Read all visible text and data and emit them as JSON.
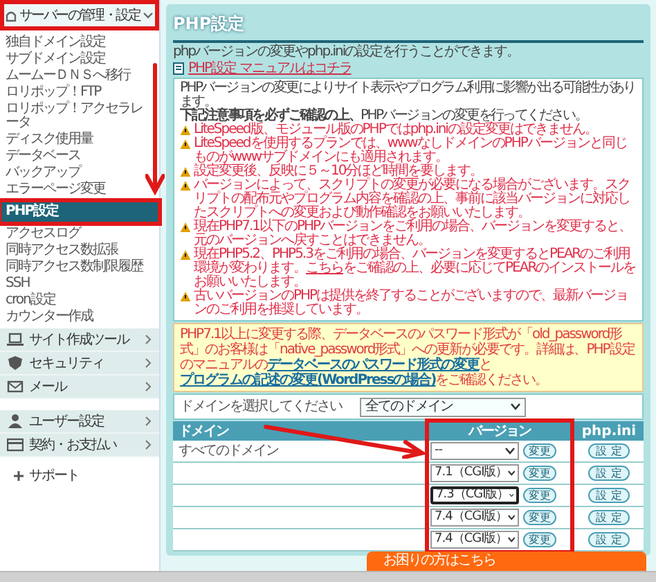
{
  "sidebar": {
    "section": {
      "label": "サーバーの管理・設定",
      "expanded": true
    },
    "items": [
      {
        "label": "独自ドメイン設定",
        "selected": false
      },
      {
        "label": "サブドメイン設定",
        "selected": false
      },
      {
        "label": "ムームーＤＮＳへ移行",
        "selected": false
      },
      {
        "label": "ロリポップ！FTP",
        "selected": false
      },
      {
        "label": "ロリポップ！アクセラレータ",
        "selected": false
      },
      {
        "label": "ディスク使用量",
        "selected": false
      },
      {
        "label": "データベース",
        "selected": false
      },
      {
        "label": "バックアップ",
        "selected": false
      },
      {
        "label": "エラーページ変更",
        "selected": false
      },
      {
        "label": "PHP設定",
        "selected": true
      },
      {
        "label": "アクセスログ",
        "selected": false
      },
      {
        "label": "同時アクセス数拡張",
        "selected": false
      },
      {
        "label": "同時アクセス数制限履歴",
        "selected": false
      },
      {
        "label": "SSH",
        "selected": false
      },
      {
        "label": "cron設定",
        "selected": false
      },
      {
        "label": "カウンター作成",
        "selected": false
      }
    ],
    "groups": [
      {
        "label": "サイト作成ツール",
        "kind": "laptop"
      },
      {
        "label": "セキュリティ",
        "kind": "shield"
      },
      {
        "label": "メール",
        "kind": "mail"
      }
    ],
    "account_groups": [
      {
        "label": "ユーザー設定",
        "kind": "user"
      },
      {
        "label": "契約・お支払い",
        "kind": "card"
      }
    ],
    "support": {
      "label": "サポート"
    }
  },
  "page": {
    "title": "PHP設定",
    "description": "phpバージョンの変更やphp.iniの設定を行うことができます。",
    "manual_link": "PHP設定 マニュアルはコチラ"
  },
  "notice": {
    "lines": [
      "PHPバージョンの変更によりサイト表示やプログラム利用に影響が出る可能性があります。",
      "**下記注意事項を必ずご確認の上、**PHPバージョンの変更を行ってください。"
    ],
    "warnings": [
      {
        "kind": "plain",
        "text": "LiteSpeed版、モジュール版のPHPではphp.iniの設定変更はできません。"
      },
      {
        "kind": "plain",
        "text": "LiteSpeedを使用するプランでは、wwwなしドメインのPHPバージョンと同じものがwwwサブドメインにも適用されます。"
      },
      {
        "kind": "plain",
        "text": "設定変更後、反映に５～10分ほど時間を要します。"
      },
      {
        "kind": "plain",
        "text": "バージョンによって、スクリプトの変更が必要になる場合がございます。スクリプトの配布元やプログラム内容を確認の上、事前に該当バージョンに対応したスクリプトへの変更および動作確認をお願いいたします。"
      },
      {
        "kind": "plain",
        "text": "現在PHP7.1以下のPHPバージョンをご利用の場合、バージョンを変更すると、元のバージョンへ戻すことはできません。"
      },
      {
        "kind": "link",
        "text": "現在PHP5.2、PHP5.3をご利用の場合、バージョンを変更するとPEARのご利用環境が変わります。",
        "link": "こちら",
        "after": "をご確認の上、必要に応じてPEARのインストールをお願いいたします。"
      },
      {
        "kind": "plain",
        "text": "古いバージョンのPHPは提供を終了することがございますので、最新バージョンのご利用を推奨しています。"
      }
    ]
  },
  "database_notice": {
    "parts": [
      {
        "kind": "text",
        "text": "PHP7.1以上に変更する際、データベースのパスワード形式が「old_password形式」のお客様は「native_password形式」への更新が必要です。詳細は、PHP設定のマニュアルの"
      },
      {
        "kind": "link",
        "text": "データベースのパスワード形式の変更"
      },
      {
        "kind": "text",
        "text": "と"
      },
      {
        "kind": "link",
        "text": "プログラムの記述の変更(WordPressの場合)"
      },
      {
        "kind": "text",
        "text": "をご確認ください。"
      }
    ]
  },
  "domain_filter": {
    "label": "ドメインを選択してください",
    "value": "全てのドメイン"
  },
  "table": {
    "columns": [
      "ドメイン",
      "バージョン",
      "php.ini"
    ],
    "rows": [
      {
        "domain": "すべてのドメイン",
        "version": "--",
        "focused": false,
        "change_button": "変更",
        "ini_button": "設 定"
      },
      {
        "version": "7.1（CGI版）",
        "focused": false,
        "change_button": "変更",
        "ini_button": "設 定"
      },
      {
        "version": "7.3（CGI版）",
        "focused": true,
        "change_button": "変更",
        "ini_button": "設 定"
      },
      {
        "version": "7.4（CGI版）",
        "focused": false,
        "change_button": "変更",
        "ini_button": "設 定"
      },
      {
        "version": "7.4（CGI版）",
        "focused": false,
        "change_button": "変更",
        "ini_button": "設 定"
      }
    ]
  },
  "help_bar": {
    "label": "お困りの方はこちら"
  }
}
